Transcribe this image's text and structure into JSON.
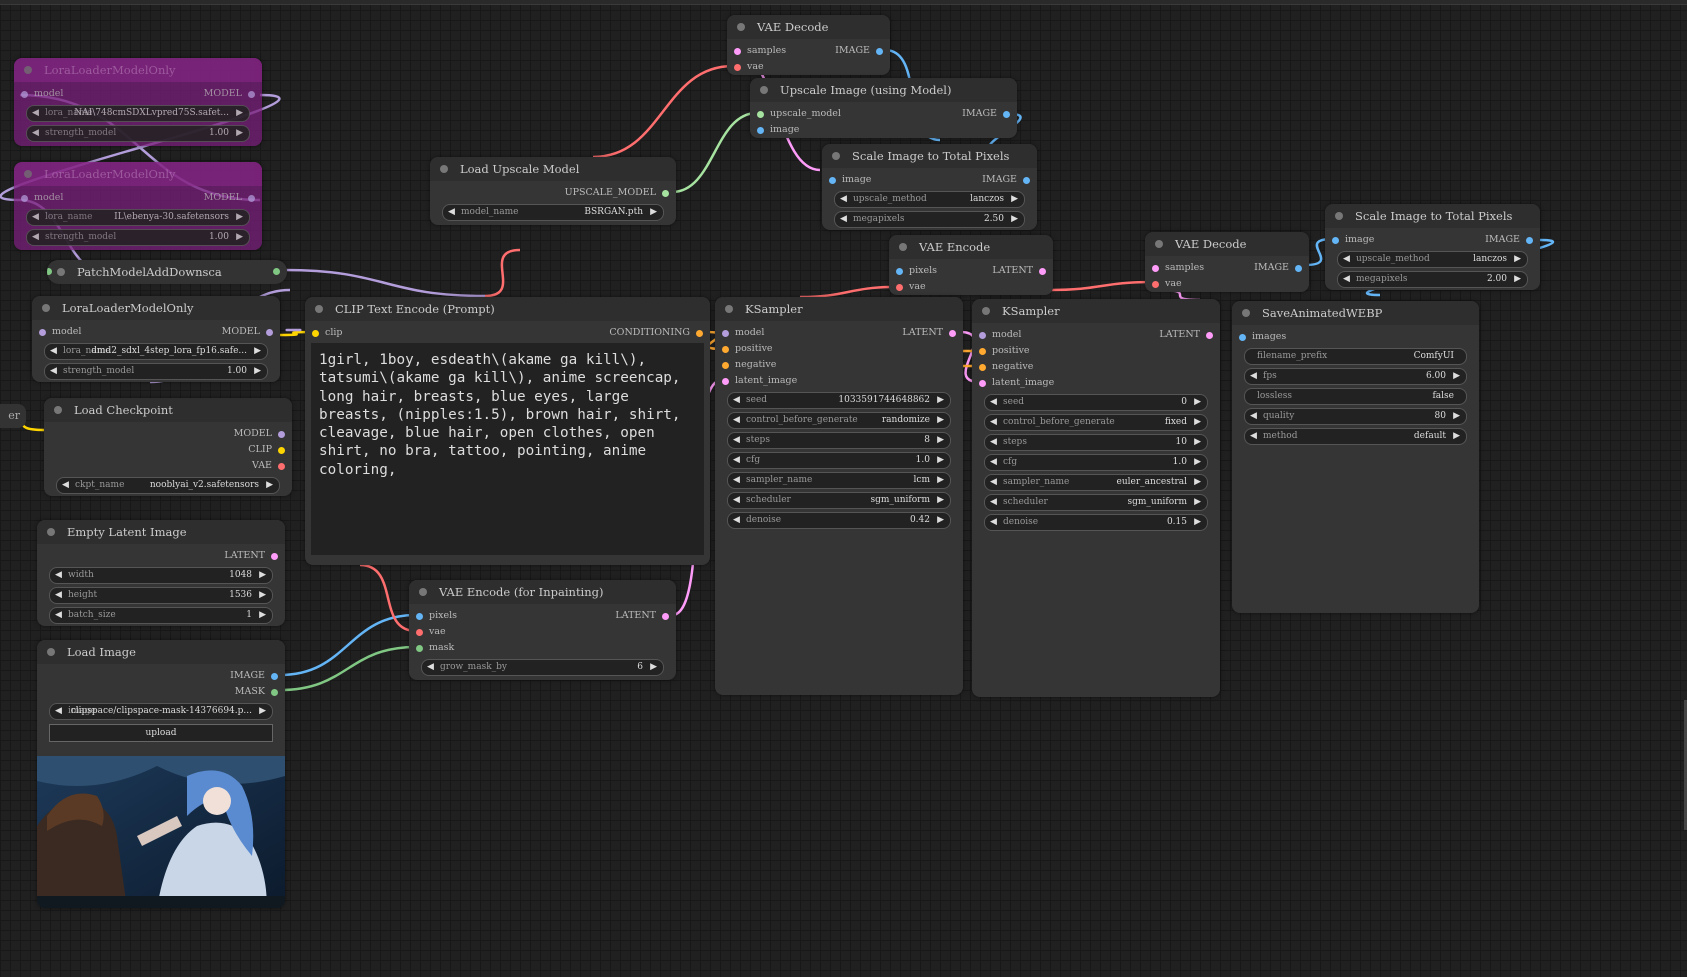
{
  "app": "ComfyUI",
  "partial_node_label": "er",
  "colors": {
    "MODEL": "#b39ddb",
    "CLIP": "#ffd500",
    "VAE": "#ff6e6e",
    "LATENT": "#ff9cf9",
    "IMAGE": "#64b5f6",
    "CONDITIONING": "#ffa931",
    "MASK": "#81c784",
    "UPSCALE_MODEL": "#a6e3a0",
    "bypass": "#7a1f7a"
  },
  "nodes": [
    {
      "id": "lora1",
      "title": "LoraLoaderModelOnly",
      "bypassed": true,
      "inputs": [
        {
          "name": "model",
          "type": "MODEL"
        }
      ],
      "outputs": [
        {
          "name": "MODEL",
          "type": "MODEL"
        }
      ],
      "widgets": [
        {
          "label": "lora_name",
          "value": "NAI\\748cmSDXLvpred75S.safet..."
        },
        {
          "label": "strength_model",
          "value": "1.00"
        }
      ]
    },
    {
      "id": "lora2",
      "title": "LoraLoaderModelOnly",
      "bypassed": true,
      "inputs": [
        {
          "name": "model",
          "type": "MODEL"
        }
      ],
      "outputs": [
        {
          "name": "MODEL",
          "type": "MODEL"
        }
      ],
      "widgets": [
        {
          "label": "lora_name",
          "value": "IL\\ebenya-30.safetensors"
        },
        {
          "label": "strength_model",
          "value": "1.00"
        }
      ]
    },
    {
      "id": "patch",
      "title": "PatchModelAddDownsca",
      "collapsed": true
    },
    {
      "id": "lora3",
      "title": "LoraLoaderModelOnly",
      "inputs": [
        {
          "name": "model",
          "type": "MODEL"
        }
      ],
      "outputs": [
        {
          "name": "MODEL",
          "type": "MODEL"
        }
      ],
      "widgets": [
        {
          "label": "lora_name",
          "value": "dmd2_sdxl_4step_lora_fp16.safe..."
        },
        {
          "label": "strength_model",
          "value": "1.00"
        }
      ]
    },
    {
      "id": "ckpt",
      "title": "Load Checkpoint",
      "inputs": [],
      "outputs": [
        {
          "name": "MODEL",
          "type": "MODEL"
        },
        {
          "name": "CLIP",
          "type": "CLIP"
        },
        {
          "name": "VAE",
          "type": "VAE"
        }
      ],
      "widgets": [
        {
          "label": "ckpt_name",
          "value": "nooblyai_v2.safetensors"
        }
      ]
    },
    {
      "id": "latent",
      "title": "Empty Latent Image",
      "inputs": [],
      "outputs": [
        {
          "name": "LATENT",
          "type": "LATENT"
        }
      ],
      "widgets": [
        {
          "label": "width",
          "value": "1048"
        },
        {
          "label": "height",
          "value": "1536"
        },
        {
          "label": "batch_size",
          "value": "1"
        }
      ]
    },
    {
      "id": "loadimg",
      "title": "Load Image",
      "inputs": [],
      "outputs": [
        {
          "name": "IMAGE",
          "type": "IMAGE"
        },
        {
          "name": "MASK",
          "type": "MASK"
        }
      ],
      "widgets": [
        {
          "label": "image",
          "value": "clipspace/clipspace-mask-14376694.p..."
        }
      ],
      "button": "upload",
      "preview": true
    },
    {
      "id": "clip",
      "title": "CLIP Text Encode (Prompt)",
      "inputs": [
        {
          "name": "clip",
          "type": "CLIP"
        }
      ],
      "outputs": [
        {
          "name": "CONDITIONING",
          "type": "CONDITIONING"
        }
      ],
      "widgets": [],
      "text": "1girl, 1boy, esdeath\\(akame ga kill\\), tatsumi\\(akame ga kill\\), anime screencap, long hair, breasts, blue eyes, large breasts, (nipples:1.5), brown hair, shirt, cleavage, blue hair, open clothes, open shirt, no bra, tattoo, pointing, anime coloring,"
    },
    {
      "id": "upmodel",
      "title": "Load Upscale Model",
      "inputs": [],
      "outputs": [
        {
          "name": "UPSCALE_MODEL",
          "type": "UPSCALE_MODEL"
        }
      ],
      "widgets": [
        {
          "label": "model_name",
          "value": "BSRGAN.pth"
        }
      ]
    },
    {
      "id": "vaedec1",
      "title": "VAE Decode",
      "inputs": [
        {
          "name": "samples",
          "type": "LATENT"
        },
        {
          "name": "vae",
          "type": "VAE"
        }
      ],
      "outputs": [
        {
          "name": "IMAGE",
          "type": "IMAGE"
        }
      ],
      "widgets": []
    },
    {
      "id": "upimg",
      "title": "Upscale Image (using Model)",
      "inputs": [
        {
          "name": "upscale_model",
          "type": "UPSCALE_MODEL"
        },
        {
          "name": "image",
          "type": "IMAGE"
        }
      ],
      "outputs": [
        {
          "name": "IMAGE",
          "type": "IMAGE"
        }
      ],
      "widgets": []
    },
    {
      "id": "scale1",
      "title": "Scale Image to Total Pixels",
      "inputs": [
        {
          "name": "image",
          "type": "IMAGE"
        }
      ],
      "outputs": [
        {
          "name": "IMAGE",
          "type": "IMAGE"
        }
      ],
      "widgets": [
        {
          "label": "upscale_method",
          "value": "lanczos"
        },
        {
          "label": "megapixels",
          "value": "2.50"
        }
      ]
    },
    {
      "id": "vaeenc",
      "title": "VAE Encode",
      "inputs": [
        {
          "name": "pixels",
          "type": "IMAGE"
        },
        {
          "name": "vae",
          "type": "VAE"
        }
      ],
      "outputs": [
        {
          "name": "LATENT",
          "type": "LATENT"
        }
      ],
      "widgets": []
    },
    {
      "id": "vaeinp",
      "title": "VAE Encode (for Inpainting)",
      "inputs": [
        {
          "name": "pixels",
          "type": "IMAGE"
        },
        {
          "name": "vae",
          "type": "VAE"
        },
        {
          "name": "mask",
          "type": "MASK"
        }
      ],
      "outputs": [
        {
          "name": "LATENT",
          "type": "LATENT"
        }
      ],
      "widgets": [
        {
          "label": "grow_mask_by",
          "value": "6"
        }
      ]
    },
    {
      "id": "ks1",
      "title": "KSampler",
      "inputs": [
        {
          "name": "model",
          "type": "MODEL"
        },
        {
          "name": "positive",
          "type": "CONDITIONING"
        },
        {
          "name": "negative",
          "type": "CONDITIONING"
        },
        {
          "name": "latent_image",
          "type": "LATENT"
        }
      ],
      "outputs": [
        {
          "name": "LATENT",
          "type": "LATENT"
        }
      ],
      "widgets": [
        {
          "label": "seed",
          "value": "1033591744648862"
        },
        {
          "label": "control_before_generate",
          "value": "randomize"
        },
        {
          "label": "steps",
          "value": "8"
        },
        {
          "label": "cfg",
          "value": "1.0"
        },
        {
          "label": "sampler_name",
          "value": "lcm"
        },
        {
          "label": "scheduler",
          "value": "sgm_uniform"
        },
        {
          "label": "denoise",
          "value": "0.42"
        }
      ]
    },
    {
      "id": "ks2",
      "title": "KSampler",
      "inputs": [
        {
          "name": "model",
          "type": "MODEL"
        },
        {
          "name": "positive",
          "type": "CONDITIONING"
        },
        {
          "name": "negative",
          "type": "CONDITIONING"
        },
        {
          "name": "latent_image",
          "type": "LATENT"
        }
      ],
      "outputs": [
        {
          "name": "LATENT",
          "type": "LATENT"
        }
      ],
      "widgets": [
        {
          "label": "seed",
          "value": "0"
        },
        {
          "label": "control_before_generate",
          "value": "fixed"
        },
        {
          "label": "steps",
          "value": "10"
        },
        {
          "label": "cfg",
          "value": "1.0"
        },
        {
          "label": "sampler_name",
          "value": "euler_ancestral"
        },
        {
          "label": "scheduler",
          "value": "sgm_uniform"
        },
        {
          "label": "denoise",
          "value": "0.15"
        }
      ]
    },
    {
      "id": "vaedec2",
      "title": "VAE Decode",
      "inputs": [
        {
          "name": "samples",
          "type": "LATENT"
        },
        {
          "name": "vae",
          "type": "VAE"
        }
      ],
      "outputs": [
        {
          "name": "IMAGE",
          "type": "IMAGE"
        }
      ],
      "widgets": []
    },
    {
      "id": "scale2",
      "title": "Scale Image to Total Pixels",
      "inputs": [
        {
          "name": "image",
          "type": "IMAGE"
        }
      ],
      "outputs": [
        {
          "name": "IMAGE",
          "type": "IMAGE"
        }
      ],
      "widgets": [
        {
          "label": "upscale_method",
          "value": "lanczos"
        },
        {
          "label": "megapixels",
          "value": "2.00"
        }
      ]
    },
    {
      "id": "webp",
      "title": "SaveAnimatedWEBP",
      "inputs": [
        {
          "name": "images",
          "type": "IMAGE"
        }
      ],
      "outputs": [],
      "widgets": [
        {
          "label": "filename_prefix",
          "value": "ComfyUI",
          "noarrow": true
        },
        {
          "label": "fps",
          "value": "6.00"
        },
        {
          "label": "lossless",
          "value": "false",
          "noarrow": true
        },
        {
          "label": "quality",
          "value": "80"
        },
        {
          "label": "method",
          "value": "default"
        }
      ]
    }
  ]
}
